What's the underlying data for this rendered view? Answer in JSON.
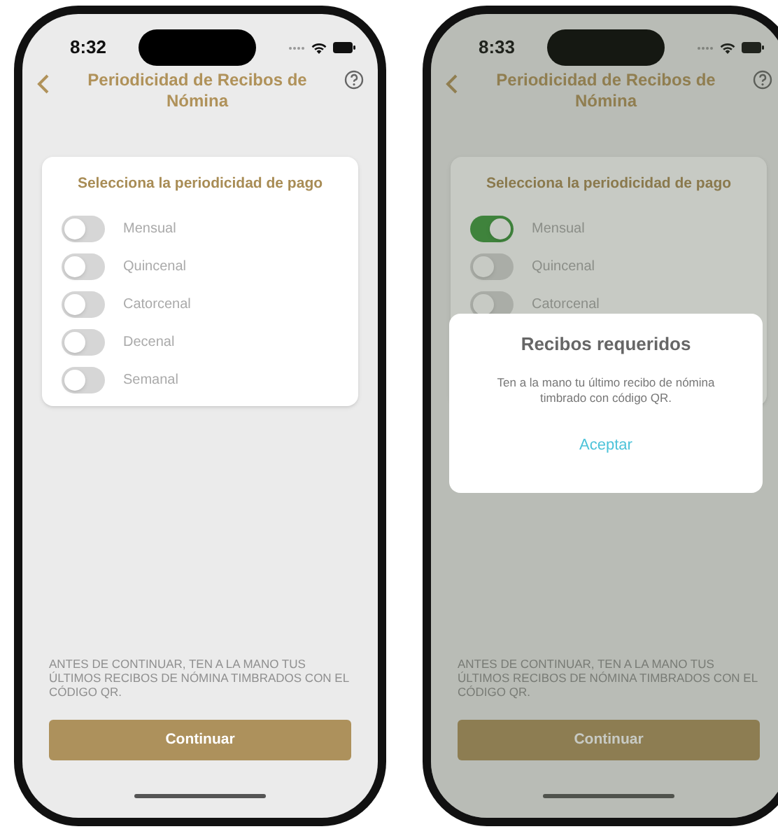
{
  "phones": [
    {
      "time": "8:32",
      "title": "Periodicidad de Recibos de Nómina",
      "card_title": "Selecciona la periodicidad de pago",
      "options": [
        {
          "label": "Mensual",
          "checked": false
        },
        {
          "label": "Quincenal",
          "checked": false
        },
        {
          "label": "Catorcenal",
          "checked": false
        },
        {
          "label": "Decenal",
          "checked": false
        },
        {
          "label": "Semanal",
          "checked": false
        }
      ],
      "note": "ANTES DE CONTINUAR, TEN A LA MANO TUS ÚLTIMOS RECIBOS DE NÓMINA TIMBRADOS CON EL CÓDIGO QR.",
      "button": "Continuar"
    },
    {
      "time": "8:33",
      "title": "Periodicidad de Recibos de Nómina",
      "card_title": "Selecciona la periodicidad de pago",
      "options": [
        {
          "label": "Mensual",
          "checked": true
        },
        {
          "label": "Quincenal",
          "checked": false
        },
        {
          "label": "Catorcenal",
          "checked": false
        }
      ],
      "note": "ANTES DE CONTINUAR, TEN A LA MANO TUS ÚLTIMOS RECIBOS DE NÓMINA TIMBRADOS CON EL CÓDIGO QR.",
      "button": "Continuar",
      "dialog": {
        "title": "Recibos requeridos",
        "message": "Ten a la mano tu último recibo de nómina timbrado con código QR.",
        "action": "Aceptar"
      }
    }
  ]
}
